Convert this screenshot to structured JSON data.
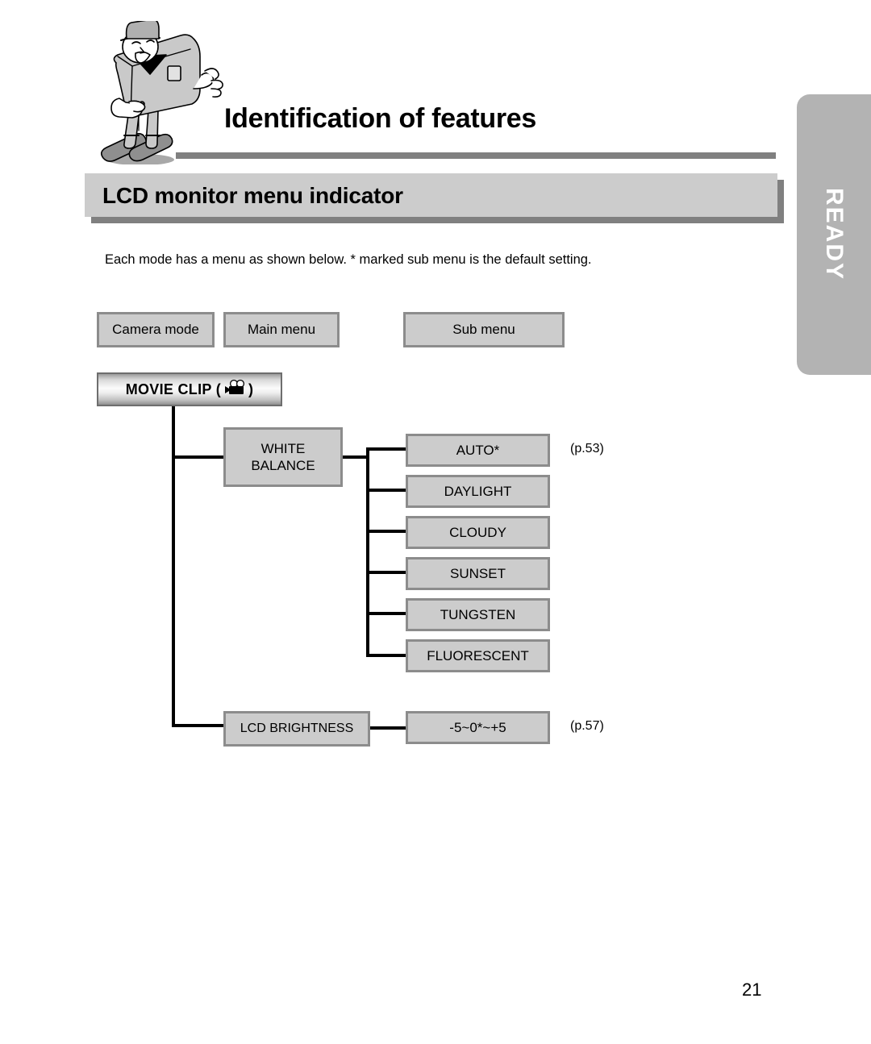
{
  "header": {
    "chapter_title": "Identification of features",
    "section_title": "LCD monitor menu indicator",
    "side_tab_label": "READY",
    "mascot_icon": "camera-mascot-icon"
  },
  "intro": {
    "text": "Each mode has a menu as shown below.  * marked sub menu is the default setting."
  },
  "legend": {
    "camera_mode": "Camera mode",
    "main_menu": "Main menu",
    "sub_menu": "Sub menu"
  },
  "mode": {
    "label": "MOVIE CLIP (",
    "label_end": ")",
    "icon": "movie-camera-icon"
  },
  "menus": [
    {
      "main": "WHITE\nBALANCE",
      "main_line1": "WHITE",
      "main_line2": "BALANCE",
      "page_ref": "(p.53)",
      "submenus": [
        "AUTO*",
        "DAYLIGHT",
        "CLOUDY",
        "SUNSET",
        "TUNGSTEN",
        "FLUORESCENT"
      ]
    },
    {
      "main": "LCD BRIGHTNESS",
      "page_ref": "(p.57)",
      "submenus": [
        "-5~0*~+5"
      ]
    }
  ],
  "footer": {
    "page_number": "21"
  },
  "colors": {
    "box_fill": "#cccccc",
    "box_border": "#8c8c8c",
    "bar_fill": "#cccccc",
    "bar_shadow": "#808080",
    "rule": "#808080",
    "tab_fill": "#b3b3b3",
    "tab_text": "#ffffff",
    "line": "#000000"
  }
}
